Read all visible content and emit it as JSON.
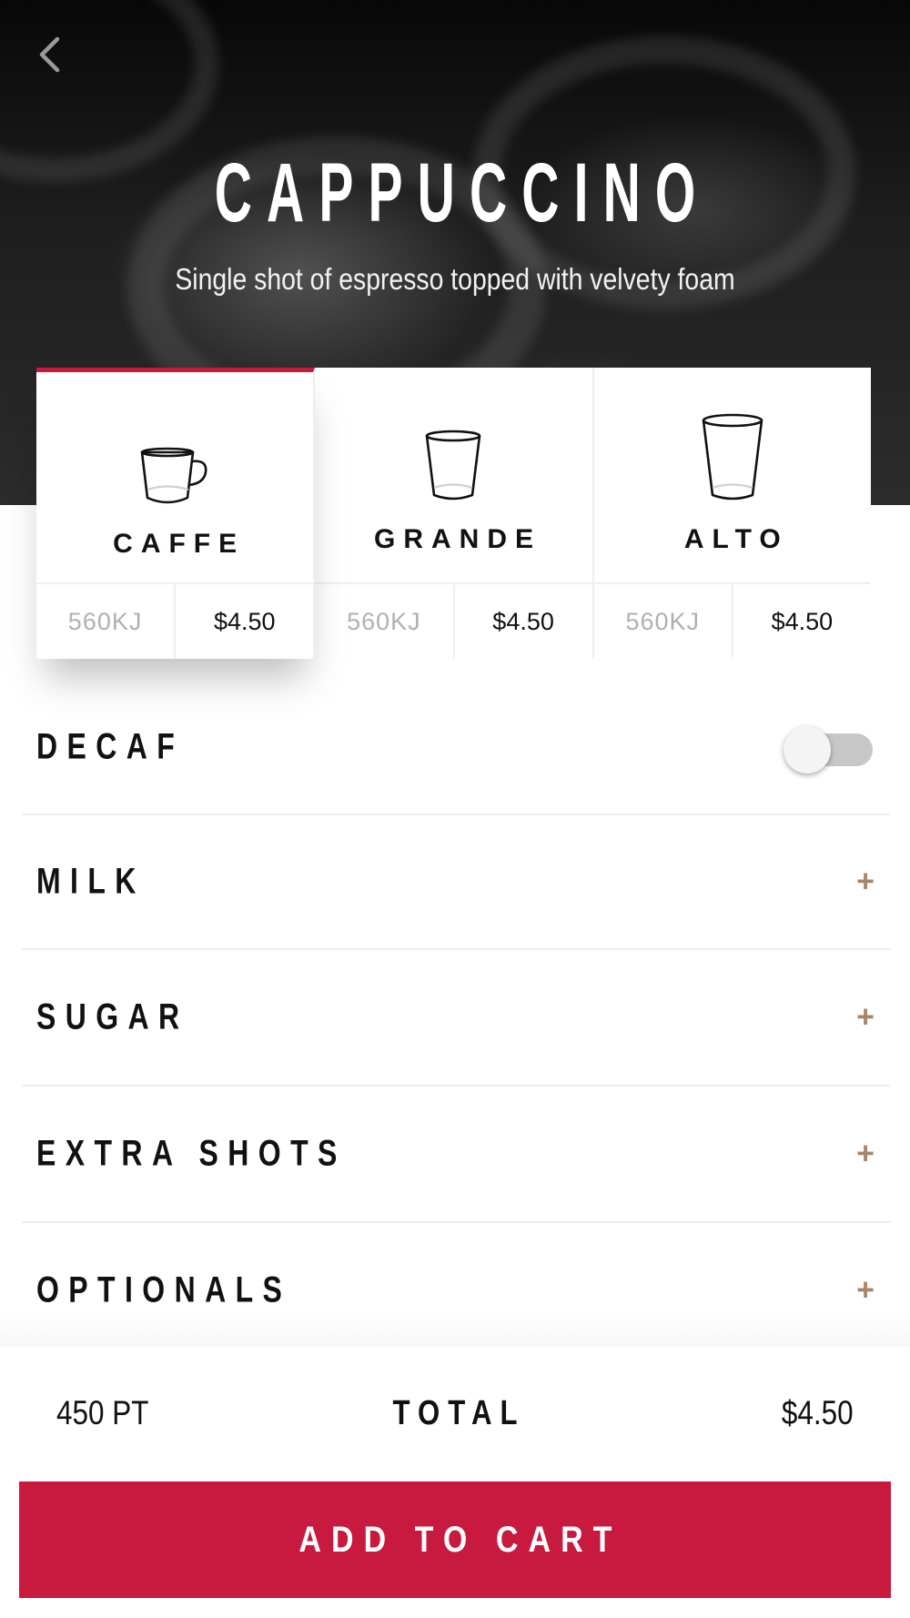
{
  "product": {
    "title": "CAPPUCCINO",
    "subtitle": "Single shot of espresso topped with velvety foam"
  },
  "nav": {
    "back_icon": "chevron-left-icon"
  },
  "sizes": [
    {
      "label": "CAFFE",
      "energy": "560KJ",
      "price": "$4.50",
      "icon": "cup-small-icon",
      "selected": true
    },
    {
      "label": "GRANDE",
      "energy": "560KJ",
      "price": "$4.50",
      "icon": "cup-medium-icon",
      "selected": false
    },
    {
      "label": "ALTO",
      "energy": "560KJ",
      "price": "$4.50",
      "icon": "cup-large-icon",
      "selected": false
    }
  ],
  "options": {
    "decaf": {
      "label": "DECAF",
      "enabled": false
    },
    "milk": {
      "label": "MILK"
    },
    "sugar": {
      "label": "SUGAR"
    },
    "extra_shots": {
      "label": "EXTRA SHOTS"
    },
    "optionals": {
      "label": "OPTIONALS"
    },
    "expand_icon": "plus-icon"
  },
  "footer": {
    "points": "450 PT",
    "total_label": "TOTAL",
    "total_value": "$4.50",
    "add_to_cart_label": "ADD TO CART"
  },
  "colors": {
    "accent": "#c8193f",
    "plus": "#a8846a",
    "muted_text": "#b0b0b0"
  }
}
